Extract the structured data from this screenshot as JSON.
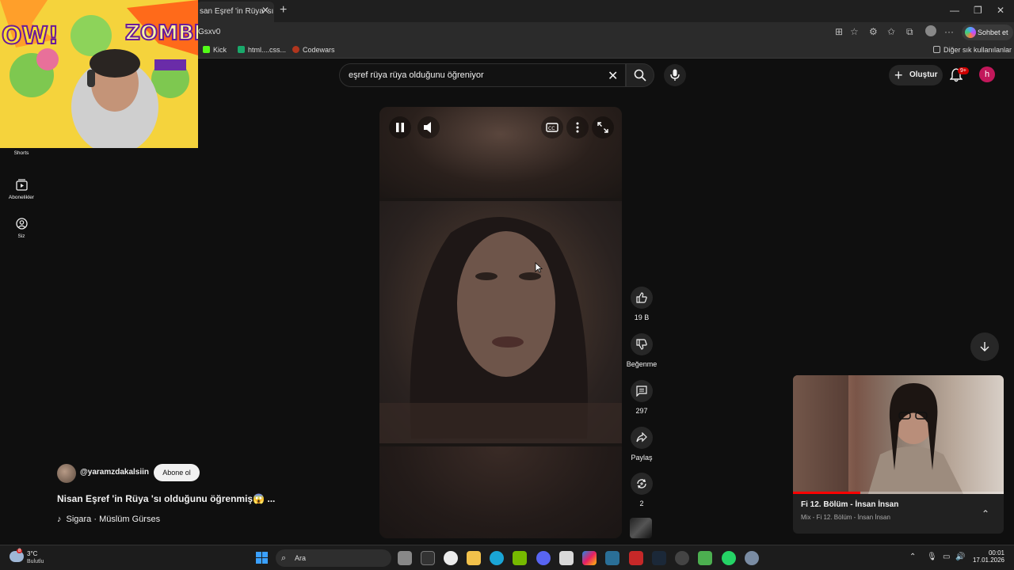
{
  "browser": {
    "tab_title": "san Eşref 'in Rüya 'sı c",
    "url": "Gsxv0",
    "copilot_label": "Sohbet et",
    "bookmarks": [
      "Kick",
      "html....css...",
      "Codewars"
    ],
    "other_bookmarks": "Diğer sık kullanılanlar"
  },
  "search": {
    "query": "eşref rüya rüya olduğunu öğreniyor"
  },
  "header": {
    "create_label": "Oluştur",
    "notif_count": "9+",
    "avatar_letter": "h"
  },
  "sidebar": {
    "items": [
      {
        "label": "Shorts",
        "icon": "shorts-icon"
      },
      {
        "label": "Abonelikler",
        "icon": "subscriptions-icon"
      },
      {
        "label": "Siz",
        "icon": "you-icon"
      }
    ]
  },
  "actions": {
    "like_count": "19 B",
    "dislike_label": "Beğenme",
    "comment_count": "297",
    "share_label": "Paylaş",
    "remix_count": "2"
  },
  "channel": {
    "name": "@yaramzdakalsiin",
    "subscribe_label": "Abone ol",
    "video_title": "Nisan Eşref 'in Rüya 'sı olduğunu öğrenmiş😱 ...",
    "music": "Sigara · Müslüm Gürses"
  },
  "miniplayer": {
    "title": "Fi 12. Bölüm - İnsan İnsan",
    "subtitle": "Mix - Fi 12. Bölüm - İnsan İnsan",
    "progress_fraction": 0.32
  },
  "taskbar": {
    "temperature": "3°C",
    "condition": "Bulutlu",
    "weather_badge": "8",
    "search_placeholder": "Ara",
    "time": "00:01",
    "date": "17.01.2026"
  },
  "colors": {
    "background": "#0f0f0f",
    "accent_red": "#ff0000",
    "avatar": "#c2185b"
  }
}
